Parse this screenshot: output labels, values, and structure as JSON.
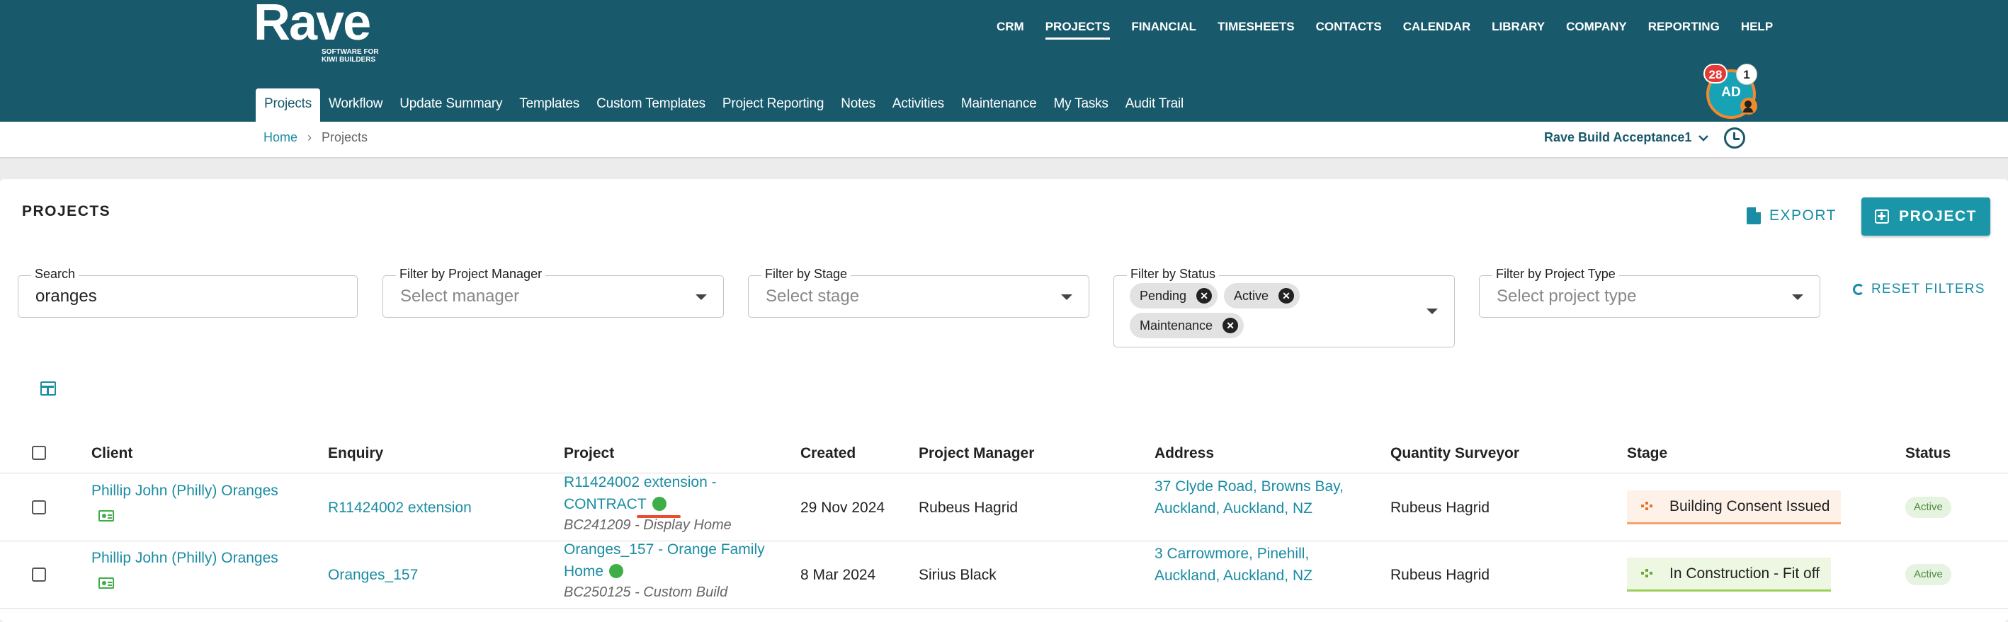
{
  "brand": {
    "word": "Rave",
    "tagline": "SOFTWARE FOR KIWI BUILDERS"
  },
  "main_nav": [
    "CRM",
    "PROJECTS",
    "FINANCIAL",
    "TIMESHEETS",
    "CONTACTS",
    "CALENDAR",
    "LIBRARY",
    "COMPANY",
    "REPORTING",
    "HELP"
  ],
  "main_nav_active": "PROJECTS",
  "user": {
    "initials": "AD",
    "notifications": "28",
    "messages": "1"
  },
  "sub_nav": [
    "Projects",
    "Workflow",
    "Update Summary",
    "Templates",
    "Custom Templates",
    "Project Reporting",
    "Notes",
    "Activities",
    "Maintenance",
    "My Tasks",
    "Audit Trail"
  ],
  "sub_nav_active": "Projects",
  "breadcrumb": {
    "home": "Home",
    "separator": "›",
    "current": "Projects"
  },
  "company": {
    "name": "Rave Build Acceptance1"
  },
  "page": {
    "title": "PROJECTS",
    "export_label": "EXPORT",
    "new_project_label": "PROJECT",
    "reset_label": "RESET FILTERS"
  },
  "filters": {
    "search": {
      "label": "Search",
      "value": "oranges"
    },
    "manager": {
      "label": "Filter by Project Manager",
      "placeholder": "Select manager"
    },
    "stage": {
      "label": "Filter by Stage",
      "placeholder": "Select stage"
    },
    "status": {
      "label": "Filter by Status",
      "chips": [
        "Pending",
        "Active",
        "Maintenance"
      ]
    },
    "type": {
      "label": "Filter by Project Type",
      "placeholder": "Select project type"
    }
  },
  "table": {
    "headers": [
      "Client",
      "Enquiry",
      "Project",
      "Created",
      "Project Manager",
      "Address",
      "Quantity Surveyor",
      "Stage",
      "Status"
    ],
    "rows": [
      {
        "client": "Phillip John (Philly) Oranges",
        "enquiry": "R11424002 extension",
        "project_line1": "R11424002 extension -",
        "project_line2": "CONTRACT",
        "project_sub": "BC241209 - Display Home",
        "created": "29 Nov 2024",
        "manager": "Rubeus Hagrid",
        "address_line1": "37 Clyde Road, Browns Bay,",
        "address_line2": "Auckland, Auckland, NZ",
        "surveyor": "Rubeus Hagrid",
        "stage": "Building Consent Issued",
        "stage_color": "#f4a46a",
        "status": "Active"
      },
      {
        "client": "Phillip John (Philly) Oranges",
        "enquiry": "Oranges_157",
        "project_line1": "Oranges_157 - Orange Family",
        "project_line2": "Home",
        "project_sub": "BC250125 - Custom Build",
        "created": "8 Mar 2024",
        "manager": "Sirius Black",
        "address_line1": "3 Carrowmore, Pinehill,",
        "address_line2": "Auckland, Auckland, NZ",
        "surveyor": "Rubeus Hagrid",
        "stage": "In Construction - Fit off",
        "stage_color": "#9bcf57",
        "status": "Active"
      }
    ]
  },
  "colors": {
    "header_bg": "#18596b",
    "accent": "#1a8ca3",
    "status_dot": "#3fae49"
  }
}
